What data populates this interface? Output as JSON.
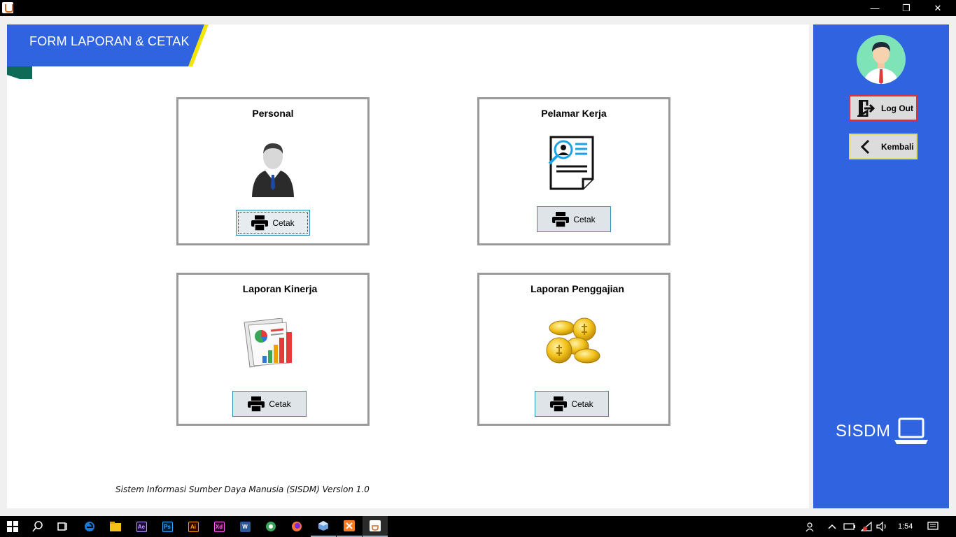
{
  "window": {
    "title": "",
    "controls": {
      "minimize": "—",
      "maximize": "❐",
      "close": "✕"
    }
  },
  "header": {
    "title": "FORM LAPORAN & CETAK"
  },
  "cards": [
    {
      "title": "Personal",
      "icon": "businessman-icon",
      "button_label": "Cetak"
    },
    {
      "title": "Pelamar Kerja",
      "icon": "resume-search-icon",
      "button_label": "Cetak"
    },
    {
      "title": "Laporan Kinerja",
      "icon": "report-chart-icon",
      "button_label": "Cetak"
    },
    {
      "title": "Laporan Penggajian",
      "icon": "gold-coins-icon",
      "button_label": "Cetak"
    }
  ],
  "footer": {
    "text": "Sistem Informasi Sumber Daya Manusia (SISDM) Version 1.0"
  },
  "sidebar": {
    "logout_label": "Log Out",
    "back_label": "Kembali",
    "brand": "SISDM"
  },
  "taskbar": {
    "apps": [
      "windows-start-icon",
      "search-icon",
      "task-view-icon",
      "edge-icon",
      "file-explorer-icon",
      "after-effects-icon",
      "photoshop-icon",
      "illustrator-icon",
      "xd-icon",
      "word-icon",
      "greenfoot-icon",
      "firefox-icon",
      "virtualbox-icon",
      "xampp-icon",
      "java-icon"
    ],
    "app_labels": {
      "ae": "Ae",
      "ps": "Ps",
      "ai": "Ai",
      "xd": "Xd",
      "word": "W"
    },
    "clock": "1:54"
  },
  "colors": {
    "header_blue": "#2f63e0",
    "sidebar_blue": "#2f63e0",
    "accent_yellow": "#f2e600",
    "accent_green": "#0f6b58",
    "logout_border": "#e0303a",
    "back_border": "#e6d96a"
  }
}
